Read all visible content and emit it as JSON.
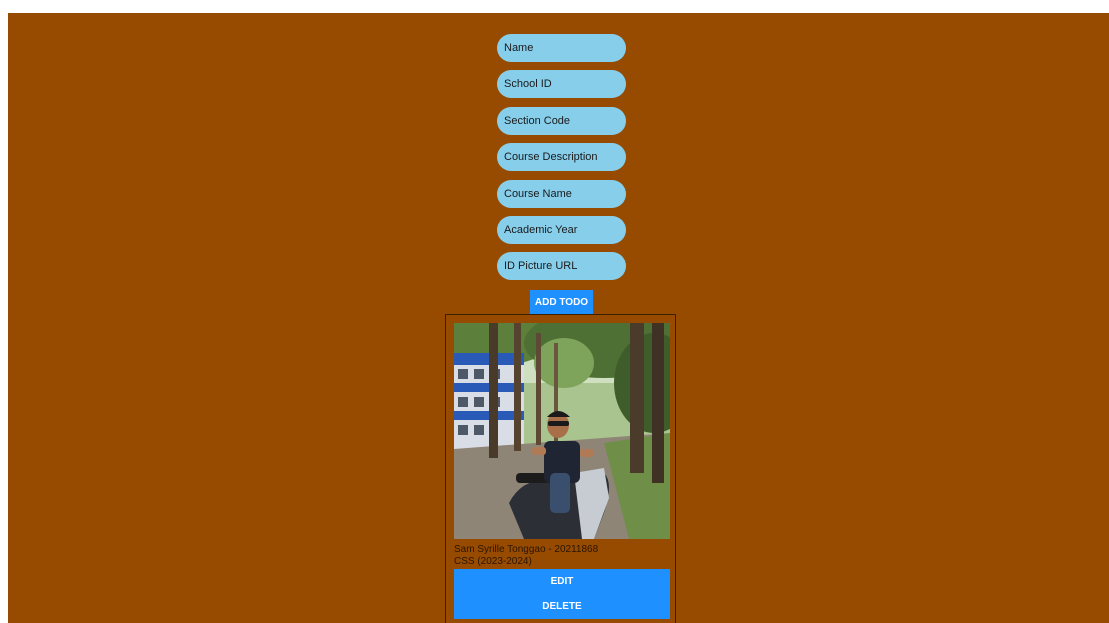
{
  "form": {
    "fields": [
      {
        "placeholder": "Name"
      },
      {
        "placeholder": "School ID"
      },
      {
        "placeholder": "Section Code"
      },
      {
        "placeholder": "Course Description"
      },
      {
        "placeholder": "Course Name"
      },
      {
        "placeholder": "Academic Year"
      },
      {
        "placeholder": "ID Picture URL"
      }
    ],
    "add_label": "ADD TODO"
  },
  "card": {
    "name_line": "Sam Syrille Tonggao - 20211868",
    "course_line": "CSS (2023-2024)",
    "edit_label": "EDIT",
    "delete_label": "DELETE"
  },
  "colors": {
    "background": "#964b00",
    "input": "#87ceeb",
    "button": "#1e90ff"
  }
}
